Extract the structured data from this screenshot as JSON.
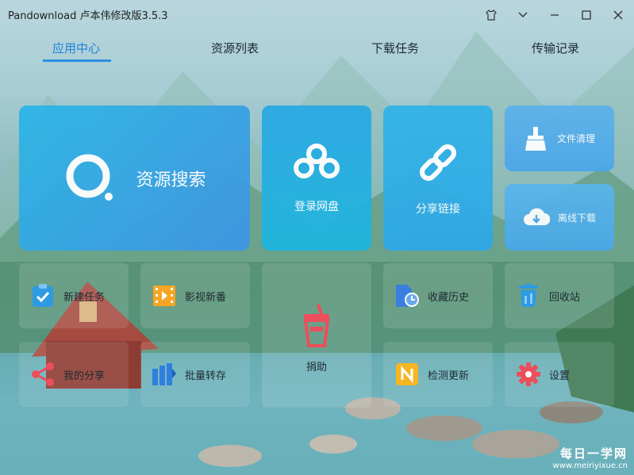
{
  "window": {
    "title": "Pandownload 卢本伟修改版3.5.3"
  },
  "tabs": [
    {
      "label": "应用中心"
    },
    {
      "label": "资源列表"
    },
    {
      "label": "下载任务"
    },
    {
      "label": "传输记录"
    }
  ],
  "tiles": {
    "search": "资源搜索",
    "login": "登录网盘",
    "share": "分享链接",
    "clean": "文件清理",
    "offline": "离线下载"
  },
  "tools": {
    "new_task": "新建任务",
    "video": "影视新番",
    "donate": "捐助",
    "history": "收藏历史",
    "recycle": "回收站",
    "my_share": "我的分享",
    "batch": "批量转存",
    "update": "检测更新",
    "settings": "设置"
  },
  "watermark": {
    "main": "每日一学网",
    "url": "www.meiriyixue.cn"
  },
  "colors": {
    "accent": "#1f83d8",
    "tile_blue": "#2aa7e0"
  }
}
